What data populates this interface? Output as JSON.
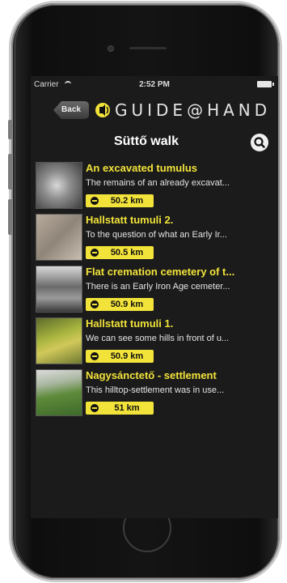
{
  "status_bar": {
    "carrier": "Carrier",
    "time": "2:52 PM"
  },
  "nav": {
    "back_label": "Back",
    "logo_text": "GUIDE@HAND"
  },
  "page": {
    "title": "Süttő walk"
  },
  "items": [
    {
      "title": "An excavated tumulus",
      "description": "The remains of an already excavat...",
      "distance": "50.2 km"
    },
    {
      "title": "Hallstatt tumuli 2.",
      "description": "To the question of what an Early Ir...",
      "distance": "50.5 km"
    },
    {
      "title": "Flat cremation cemetery of t...",
      "description": "There is an Early Iron Age cemeter...",
      "distance": "50.9 km"
    },
    {
      "title": "Hallstatt tumuli 1.",
      "description": "We can see some hills in front of u...",
      "distance": "50.9 km"
    },
    {
      "title": "Nagysánctető - settlement",
      "description": "This hilltop-settlement was in use...",
      "distance": "51 km"
    }
  ],
  "colors": {
    "accent_yellow": "#f2e33a",
    "screen_background": "#1b1b1b"
  }
}
